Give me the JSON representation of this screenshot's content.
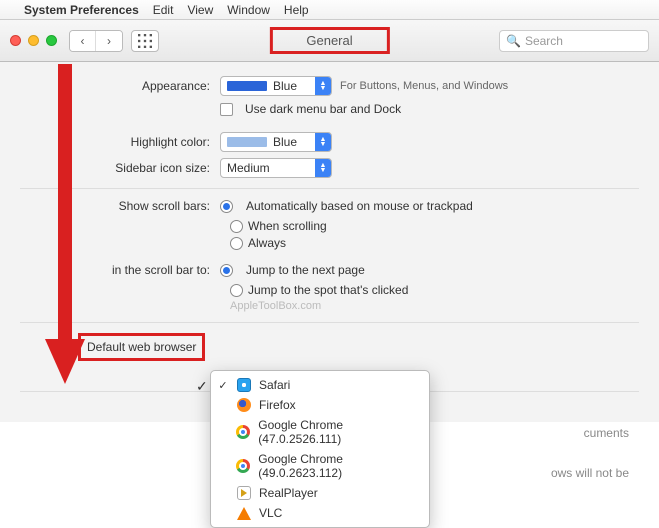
{
  "menubar": {
    "items": [
      "System Preferences",
      "Edit",
      "View",
      "Window",
      "Help"
    ]
  },
  "toolbar": {
    "title": "General",
    "search_placeholder": "Search"
  },
  "appearance": {
    "label": "Appearance:",
    "value": "Blue",
    "hint": "For Buttons, Menus, and Windows",
    "dark_label": "Use dark menu bar and Dock"
  },
  "highlight": {
    "label": "Highlight color:",
    "value": "Blue"
  },
  "sidebar_size": {
    "label": "Sidebar icon size:",
    "value": "Medium"
  },
  "scrollbars": {
    "label": "Show scroll bars:",
    "options": [
      "Automatically based on mouse or trackpad",
      "When scrolling",
      "Always"
    ],
    "selected": 0
  },
  "scrollclick": {
    "label": "in the scroll bar to:",
    "options": [
      "Jump to the next page",
      "Jump to the spot that's clicked"
    ],
    "selected": 0
  },
  "watermark": "AppleToolBox.com",
  "default_browser": {
    "label": "Default web browser",
    "options": [
      {
        "name": "Safari",
        "icon": "safari"
      },
      {
        "name": "Firefox",
        "icon": "firefox"
      },
      {
        "name": "Google Chrome (47.0.2526.111)",
        "icon": "chrome"
      },
      {
        "name": "Google Chrome (49.0.2623.112)",
        "icon": "chrome"
      },
      {
        "name": "RealPlayer",
        "icon": "realplayer"
      },
      {
        "name": "VLC",
        "icon": "vlc"
      }
    ],
    "selected": 0
  },
  "trailing": {
    "right1": "cuments",
    "right2": "ows will not be"
  }
}
